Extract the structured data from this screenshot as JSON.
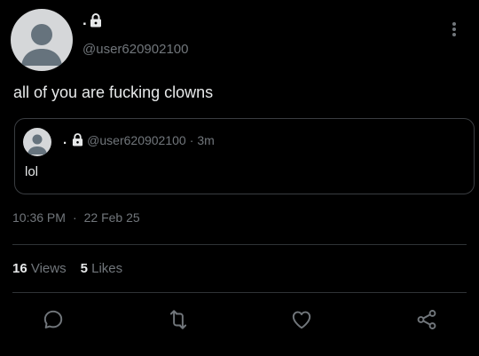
{
  "author": {
    "display_name": ".",
    "handle": "@user620902100"
  },
  "tweet": {
    "text": "all of you are fucking clowns",
    "time": "10:36 PM",
    "separator": "·",
    "date": "22 Feb 25"
  },
  "quoted": {
    "display_name": ".",
    "handle": "@user620902100",
    "separator": "·",
    "age": "3m",
    "text": "lol"
  },
  "stats": {
    "views_count": "16",
    "views_label": "Views",
    "likes_count": "5",
    "likes_label": "Likes"
  },
  "icons": {
    "lock": "lock-icon",
    "more": "more-vertical-icon",
    "reply": "reply-icon",
    "retweet": "retweet-icon",
    "like": "heart-icon",
    "share": "share-icon"
  },
  "colors": {
    "background": "#000000",
    "primary_text": "#e7e9ea",
    "secondary_text": "#71767b",
    "divider": "#2f3336",
    "avatar": "#d5d7d9"
  }
}
